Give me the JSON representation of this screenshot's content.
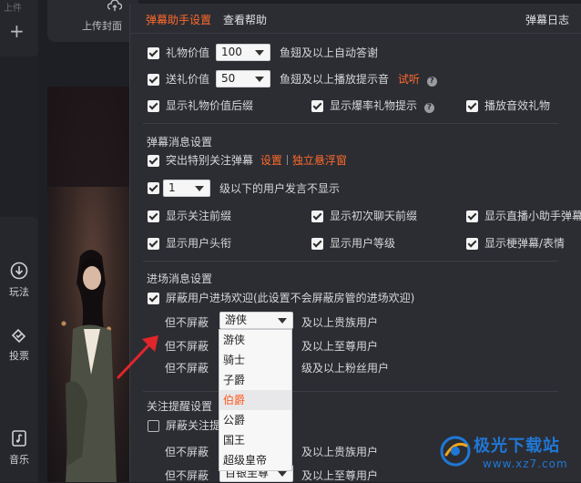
{
  "app": {
    "top_cut_text": "上件",
    "cover_label": "上传封面",
    "tools": [
      {
        "label": "玩法",
        "icon": "download-circle-icon"
      },
      {
        "label": "投票",
        "icon": "vote-icon"
      },
      {
        "label": "音乐",
        "icon": "music-icon"
      }
    ]
  },
  "panel": {
    "tabs": [
      "弹幕助手设置",
      "查看帮助"
    ],
    "log_label": "弹幕日志",
    "gift": {
      "value_label": "礼物价值",
      "value_select": "100",
      "value_suffix": "鱼翅及以上自动答谢",
      "send_label": "送礼价值",
      "send_select": "50",
      "send_suffix": "鱼翅及以上播放提示音",
      "try_listen": "试听",
      "help": "?",
      "opt_suffix": "显示礼物价值后缀",
      "opt_burst": "显示爆率礼物提示",
      "opt_sound": "播放音效礼物"
    },
    "danmu": {
      "title": "弹幕消息设置",
      "highlight": "突出特别关注弹幕",
      "settings_link": "设置",
      "float_link": "独立悬浮窗",
      "level_select": "1",
      "level_suffix": "级以下的用户发言不显示",
      "opts": [
        "显示关注前缀",
        "显示初次聊天前缀",
        "显示直播小助手弹幕",
        "显示用户头衔",
        "显示用户等级",
        "显示梗弹幕/表情"
      ]
    },
    "enter": {
      "title": "进场消息设置",
      "block_welcome": "屏蔽用户进场欢迎(此设置不会屏蔽房管的进场欢迎)",
      "rows": [
        {
          "prefix": "但不屏蔽",
          "select": "游侠",
          "suffix": "及以上贵族用户"
        },
        {
          "prefix": "但不屏蔽",
          "suffix": "及以上至尊用户"
        },
        {
          "prefix": "但不屏蔽",
          "suffix": "级及以上粉丝用户"
        }
      ]
    },
    "follow": {
      "title": "关注提醒设置",
      "block_follow": "屏蔽关注提",
      "rows": [
        {
          "prefix": "但不屏蔽",
          "suffix": "及以上贵族用户"
        },
        {
          "prefix": "但不屏蔽",
          "select": "百银至尊",
          "suffix": "及以上至尊用户"
        }
      ]
    },
    "dropdown": {
      "options": [
        "游侠",
        "骑士",
        "子爵",
        "伯爵",
        "公爵",
        "国王",
        "超级皇帝"
      ],
      "highlighted": "伯爵"
    }
  },
  "watermark": {
    "title": "极光下载站",
    "url": "www.xz7.com"
  },
  "colors": {
    "accent": "#ff6a2b",
    "arrow": "#e0262b",
    "watermark": "#1f78d6"
  }
}
